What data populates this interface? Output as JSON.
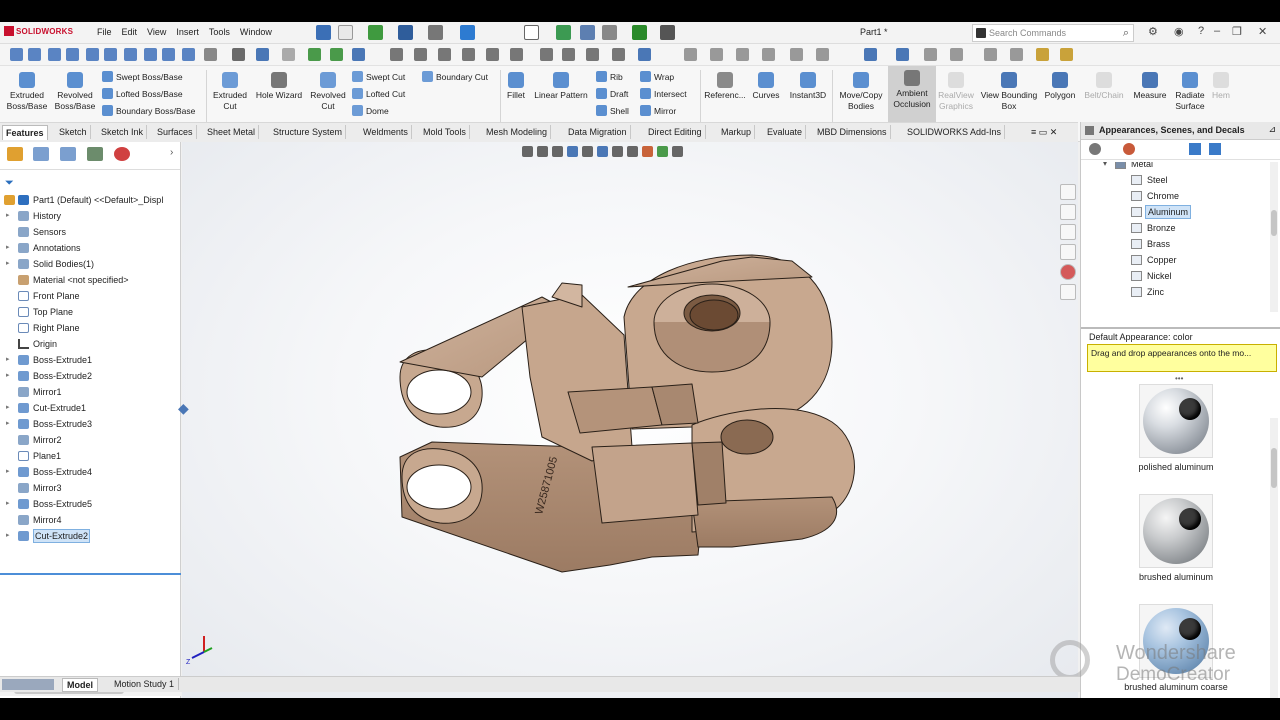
{
  "app": {
    "name": "SOLIDWORKS",
    "doc_title": "Part1 *"
  },
  "menu": [
    "File",
    "Edit",
    "View",
    "Insert",
    "Tools",
    "Window"
  ],
  "search": {
    "placeholder": "Search Commands"
  },
  "commands": {
    "extruded_boss": "Extruded Boss/Base",
    "revolved_boss": "Revolved Boss/Base",
    "swept_boss": "Swept Boss/Base",
    "lofted_boss": "Lofted Boss/Base",
    "boundary_boss": "Boundary Boss/Base",
    "extruded_cut": "Extruded Cut",
    "hole_wizard": "Hole Wizard",
    "revolved_cut": "Revolved Cut",
    "swept_cut": "Swept Cut",
    "lofted_cut": "Lofted Cut",
    "boundary_cut": "Boundary Cut",
    "dome": "Dome",
    "fillet": "Fillet",
    "linear_pattern": "Linear Pattern",
    "rib": "Rib",
    "draft": "Draft",
    "shell": "Shell",
    "wrap": "Wrap",
    "intersect": "Intersect",
    "mirror": "Mirror",
    "reference": "Referenc...",
    "curves": "Curves",
    "instant3d": "Instant3D",
    "move_copy": "Move/Copy Bodies",
    "ambient": "Ambient Occlusion",
    "realview": "RealView Graphics",
    "view_bbox": "View Bounding Box",
    "polygon": "Polygon",
    "belt_chain": "Belt/Chain",
    "measure": "Measure",
    "radiate": "Radiate Surface",
    "hem": "Hem"
  },
  "tabs": [
    "Features",
    "Sketch",
    "Sketch Ink",
    "Surfaces",
    "Sheet Metal",
    "Structure System",
    "Weldments",
    "Mold Tools",
    "Mesh Modeling",
    "Data Migration",
    "Direct Editing",
    "Markup",
    "Evaluate",
    "MBD Dimensions",
    "SOLIDWORKS Add-Ins"
  ],
  "tree": {
    "root": "Part1 (Default) <<Default>_Displ",
    "items": [
      "History",
      "Sensors",
      "Annotations",
      "Solid Bodies(1)",
      "Material <not specified>",
      "Front Plane",
      "Top Plane",
      "Right Plane",
      "Origin",
      "Boss-Extrude1",
      "Boss-Extrude2",
      "Mirror1",
      "Cut-Extrude1",
      "Boss-Extrude3",
      "Mirror2",
      "Plane1",
      "Boss-Extrude4",
      "Mirror3",
      "Boss-Extrude5",
      "Mirror4",
      "Cut-Extrude2"
    ]
  },
  "model": {
    "engraving": "W25871005"
  },
  "taskpane": {
    "title": "Appearances, Scenes, and Decals",
    "folder": "Metal",
    "materials": [
      "Steel",
      "Chrome",
      "Aluminum",
      "Bronze",
      "Brass",
      "Copper",
      "Nickel",
      "Zinc"
    ],
    "default_color": "Default Appearance: color",
    "tooltip": "Drag and drop appearances onto the mo...",
    "swatches": [
      "polished aluminum",
      "brushed aluminum",
      "brushed aluminum coarse"
    ]
  },
  "bottom_tabs": [
    "Model",
    "Motion Study 1"
  ],
  "watermark": {
    "line1": "Wondershare",
    "line2": "DemoCreator"
  },
  "colors": {
    "part": "#c8a992",
    "accent": "#c8102e",
    "selection": "#cfe3f7"
  }
}
